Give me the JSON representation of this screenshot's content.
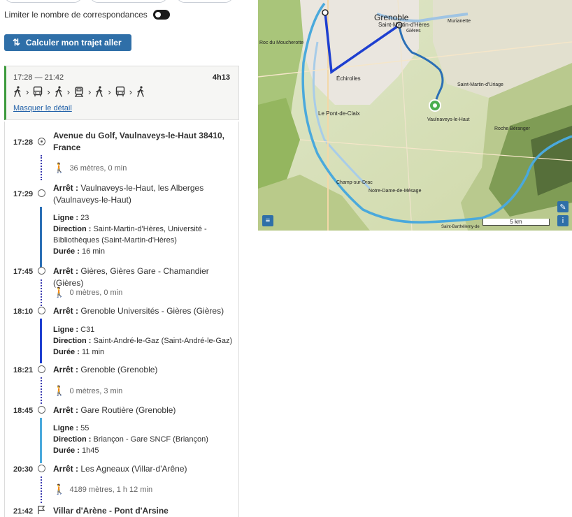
{
  "options": {
    "limit_connections_label": "Limiter le nombre de correspondances"
  },
  "actions": {
    "calculate_label": "Calculer mon trajet aller"
  },
  "summary": {
    "times": "17:28 — 21:42",
    "duration": "4h13",
    "modes": [
      "walk",
      "bus",
      "walk",
      "tram",
      "walk",
      "bus",
      "walk"
    ],
    "toggle_detail_label": "Masquer le détail",
    "accent_color": "#3c9a3c"
  },
  "itinerary": {
    "departure": {
      "time": "17:28",
      "title": "Avenue du Golf, Vaulnaveys-le-Haut 38410, France"
    },
    "walk1": {
      "text": "36 mètres, 0 min"
    },
    "stop1": {
      "time": "17:29",
      "label": "Arrêt :",
      "name": "Vaulnaveys-le-Haut, les Alberges (Vaulnaveys-le-Haut)"
    },
    "leg1": {
      "line_label": "Ligne :",
      "line": "23",
      "direction_label": "Direction :",
      "direction": "Saint-Martin-d'Hères, Université - Bibliothèques (Saint-Martin-d'Hères)",
      "duration_label": "Durée :",
      "duration": "16 min",
      "color": "#2b6fb5"
    },
    "stop2": {
      "time": "17:45",
      "label": "Arrêt :",
      "name": "Gières, Gières Gare - Chamandier (Gières)"
    },
    "walk2": {
      "text": "0 mètres, 0 min"
    },
    "stop3": {
      "time": "18:10",
      "label": "Arrêt :",
      "name": "Grenoble Universités - Gières (Gières)"
    },
    "leg2": {
      "line_label": "Ligne :",
      "line": "C31",
      "direction_label": "Direction :",
      "direction": "Saint-André-le-Gaz (Saint-André-le-Gaz)",
      "duration_label": "Durée :",
      "duration": "11 min",
      "color": "#1e3fd0"
    },
    "stop4": {
      "time": "18:21",
      "label": "Arrêt :",
      "name": "Grenoble (Grenoble)"
    },
    "walk3": {
      "text": "0 mètres, 3 min"
    },
    "stop5": {
      "time": "18:45",
      "label": "Arrêt :",
      "name": "Gare Routière (Grenoble)"
    },
    "leg3": {
      "line_label": "Ligne :",
      "line": "55",
      "direction_label": "Direction :",
      "direction": "Briançon - Gare SNCF (Briançon)",
      "duration_label": "Durée :",
      "duration": "1h45",
      "color": "#4aa9dc"
    },
    "stop6": {
      "time": "20:30",
      "label": "Arrêt :",
      "name": "Les Agneaux (Villar-d'Arêne)"
    },
    "walk4": {
      "text": "4189 mètres, 1 h 12 min"
    },
    "arrival": {
      "time": "21:42",
      "title": "Villar d'Arène - Pont d'Arsine"
    }
  },
  "map": {
    "labels": {
      "grenoble": "Grenoble",
      "smh": "Saint-Martin-d'Hères",
      "echirolles": "Échirolles",
      "pont_de_claix": "Le Pont-de-Claix",
      "vaulnaveys": "Vaulnaveys-le-Haut",
      "champ": "Champ-sur-Drac",
      "sm_uriage": "Saint-Martin-d'Uriage",
      "roche": "Roche Béranger",
      "murianette": "Murianette",
      "gieres": "Gières",
      "moucherotte": "Roc du Moucherotte",
      "saint_barth": "Saint-Barthélemy-de",
      "notre_dame": "Notre-Dame-de-Mésage"
    },
    "scale_label": "5 km",
    "layers_icon": "layers-icon",
    "edit_icon": "pencil-icon",
    "info_icon": "info-icon"
  }
}
